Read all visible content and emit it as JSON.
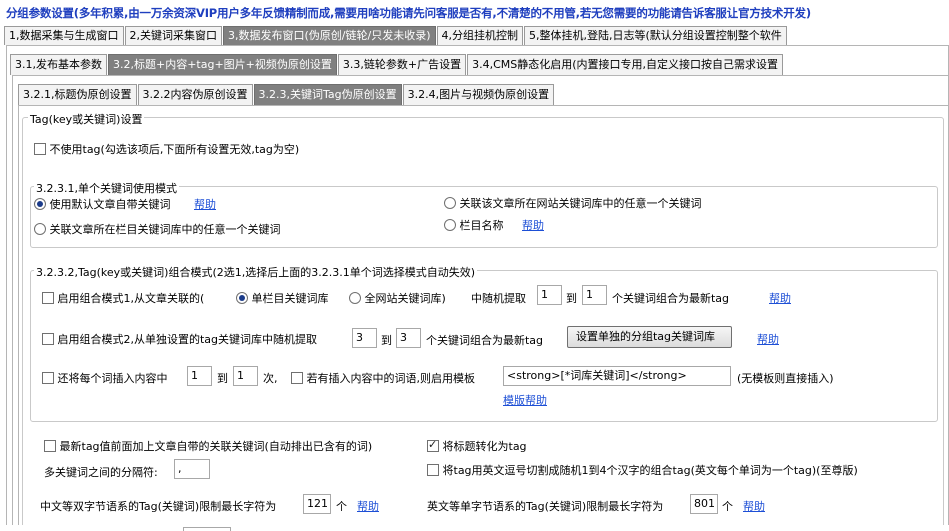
{
  "title": "分组参数设置(多年积累,由一万余资深VIP用户多年反馈精制而成,需要用啥功能请先问客服是否有,不清楚的不用管,若无您需要的功能请告诉客服让官方技术开发)",
  "main_tabs": [
    {
      "label": "1,数据采集与生成窗口",
      "active": false
    },
    {
      "label": "2,关键词采集窗口",
      "active": false
    },
    {
      "label": "3,数据发布窗口(伪原创/链轮/只发未收录)",
      "active": true
    },
    {
      "label": "4,分组挂机控制",
      "active": false
    },
    {
      "label": "5,整体挂机,登陆,日志等(默认分组设置控制整个软件",
      "active": false
    }
  ],
  "sub_tabs": [
    {
      "label": "3.1,发布基本参数",
      "active": false
    },
    {
      "label": "3.2,标题+内容+tag+图片+视频伪原创设置",
      "active": true
    },
    {
      "label": "3.3,链轮参数+广告设置",
      "active": false
    },
    {
      "label": "3.4,CMS静态化启用(内置接口专用,自定义接口按自己需求设置",
      "active": false
    }
  ],
  "third_tabs": [
    {
      "label": "3.2.1,标题伪原创设置",
      "active": false
    },
    {
      "label": "3.2.2内容伪原创设置",
      "active": false
    },
    {
      "label": "3.2.3,关键词Tag伪原创设置",
      "active": true
    },
    {
      "label": "3.2.4,图片与视频伪原创设置",
      "active": false
    }
  ],
  "outer_group_label": "Tag(key或关键词)设置",
  "no_tag": {
    "label": "不使用tag(勾选该项后,下面所有设置无效,tag为空)",
    "checked": false
  },
  "mode_group": {
    "label": "3.2.3.1,单个关键词使用模式",
    "opt_default": "使用默认文章自带关键词",
    "opt_default_help": "帮助",
    "opt_column": "关联文章所在栏目关键词库中的任意一个关键词",
    "opt_site": "关联该文章所在网站关键词库中的任意一个关键词",
    "opt_colname": "栏目名称",
    "opt_colname_help": "帮助"
  },
  "combo_group": {
    "label": "3.2.3.2,Tag(key或关键词)组合模式(2选1,选择后上面的3.2.3.1单个词选择模式自动失效)",
    "mode1": {
      "label": "启用组合模式1,从文章关联的(",
      "radio_column": "单栏目关键词库",
      "radio_site": "全网站关键词库)",
      "mid": "中随机提取",
      "from": "1",
      "to_label": "到",
      "to": "1",
      "suffix": "个关键词组合为最新tag",
      "help": "帮助"
    },
    "mode2": {
      "label": "启用组合模式2,从单独设置的tag关键词库中随机提取",
      "from": "3",
      "to_label": "到",
      "to": "3",
      "suffix": "个关键词组合为最新tag",
      "button": "设置单独的分组tag关键词库",
      "help": "帮助"
    },
    "insert": {
      "label": "还将每个词插入内容中",
      "from": "1",
      "to_label": "到",
      "to": "1",
      "times": "次,",
      "template_label": "若有插入内容中的词语,则启用模板",
      "template_value": "<strong>[*词库关键词]</strong>",
      "template_hint": "(无模板则直接插入)",
      "template_help": "模版帮助"
    }
  },
  "bottom": {
    "prepend_label": "最新tag值前面加上文章自带的关联关键词(自动排出已含有的词)",
    "title_to_tag": "将标题转化为tag",
    "split_label": "将tag用英文逗号切割成随机1到4个汉字的组合tag(英文每个单词为一个tag)(至尊版)",
    "separator_label": "多关键词之间的分隔符:",
    "separator_value": ",",
    "cn_limit_label": "中文等双字节语系的Tag(关键词)限制最长字符为",
    "cn_limit_value": "121",
    "cn_unit": "个",
    "cn_help": "帮助",
    "en_limit_label": "英文等单字节语系的Tag(关键词)限制最长字符为",
    "en_limit_value": "801",
    "en_unit": "个",
    "en_help": "帮助"
  }
}
